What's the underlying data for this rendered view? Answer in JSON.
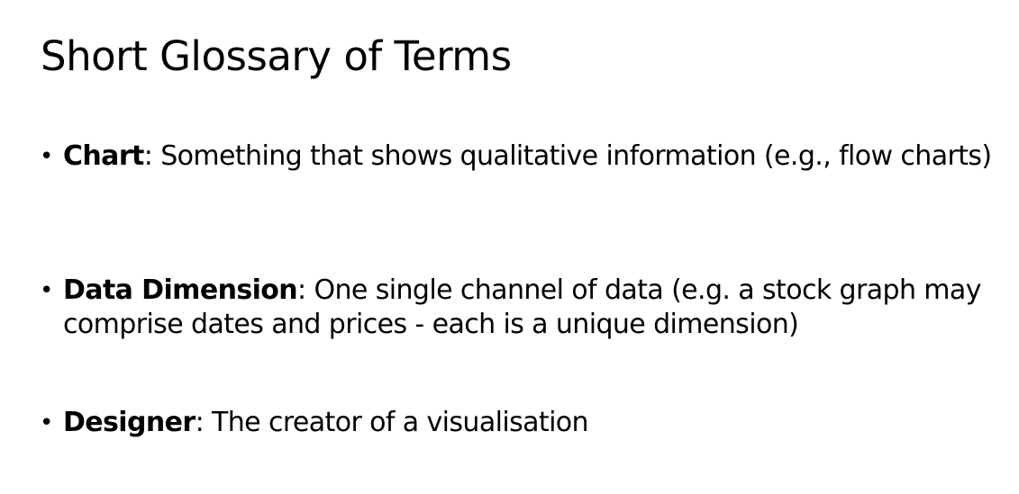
{
  "slide": {
    "title": "Short Glossary of Terms",
    "bullet_symbol": "•",
    "items": [
      {
        "term": "Chart",
        "definition": ": Something that shows qualitative information (e.g., flow charts)"
      },
      {
        "term": "Data Dimension",
        "definition": ": One single channel of data (e.g. a stock graph may comprise dates and prices - each is a unique dimension)"
      },
      {
        "term": "Designer",
        "definition": ": The creator of a visualisation"
      }
    ]
  }
}
